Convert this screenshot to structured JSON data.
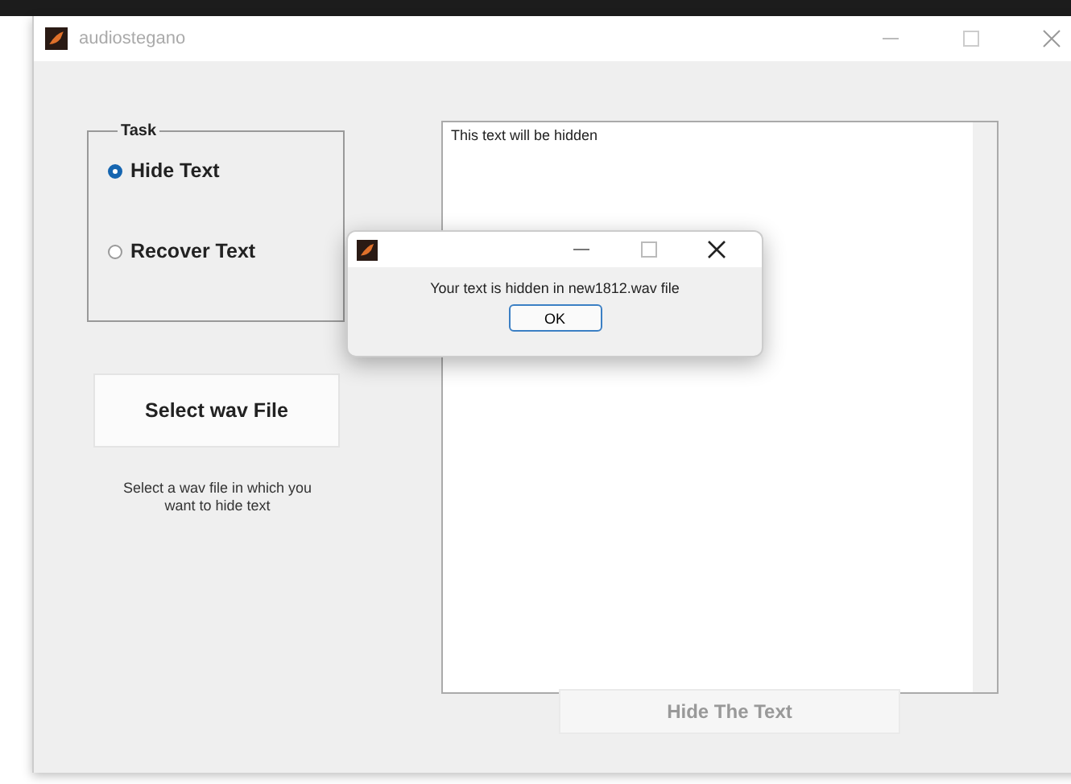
{
  "window": {
    "title": "audiostegano"
  },
  "task_group": {
    "label": "Task",
    "options": [
      {
        "label": "Hide Text",
        "selected": true
      },
      {
        "label": "Recover Text",
        "selected": false
      }
    ]
  },
  "select_button": {
    "label": "Select wav File"
  },
  "hint": "Select a wav file in which you want to hide text",
  "text_area": {
    "value": "This text will be hidden"
  },
  "hide_button": {
    "label": "Hide The Text",
    "disabled": true
  },
  "dialog": {
    "message": "Your text is hidden in  new1812.wav file",
    "ok_button": "OK"
  }
}
